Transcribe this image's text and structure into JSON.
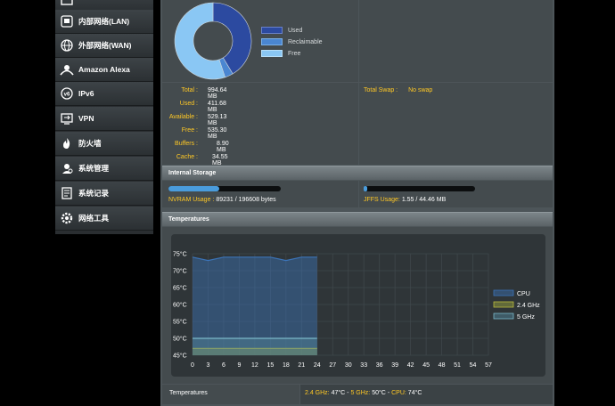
{
  "sidebar": {
    "items": [
      {
        "label": "",
        "icon": "partial-icon"
      },
      {
        "label": "内部网络(LAN)",
        "icon": "lan-icon"
      },
      {
        "label": "外部网络(WAN)",
        "icon": "globe-icon"
      },
      {
        "label": "Amazon Alexa",
        "icon": "alexa-icon"
      },
      {
        "label": "IPv6",
        "icon": "ipv6-icon"
      },
      {
        "label": "VPN",
        "icon": "vpn-icon"
      },
      {
        "label": "防火墙",
        "icon": "firewall-icon"
      },
      {
        "label": "系统管理",
        "icon": "admin-icon"
      },
      {
        "label": "系统记录",
        "icon": "log-icon"
      },
      {
        "label": "网络工具",
        "icon": "tools-icon"
      }
    ]
  },
  "memory": {
    "legend": [
      {
        "label": "Used",
        "color": "#2c4aa0"
      },
      {
        "label": "Reclaimable",
        "color": "#4a86d1"
      },
      {
        "label": "Free",
        "color": "#8ac7f4"
      }
    ],
    "pie_fractions": {
      "used": 0.414,
      "reclaimable": 0.035,
      "free": 0.551
    },
    "stats": [
      {
        "label": "Total :",
        "value": "994.64 MB"
      },
      {
        "label": "Used :",
        "value": "411.68 MB"
      },
      {
        "label": "Available :",
        "value": "529.13 MB"
      },
      {
        "label": "Free :",
        "value": "535.30 MB"
      },
      {
        "label": "Buffers :",
        "value": "8.90 MB"
      },
      {
        "label": "Cache :",
        "value": "34.55 MB"
      }
    ],
    "swap_label": "Total Swap :",
    "swap_value": "No swap"
  },
  "storage": {
    "title": "Internal Storage",
    "nvram_label": "NVRAM Usage :",
    "nvram_value": "89231 / 196608 bytes",
    "nvram_fraction": 0.454,
    "jffs_label": "JFFS Usage:",
    "jffs_value": "1.55 / 44.46 MB",
    "jffs_fraction": 0.035
  },
  "temperatures": {
    "title": "Temperatures",
    "footer_label": "Temperatures",
    "readout": {
      "g24_label": "2.4 GHz:",
      "g24_value": "47°C",
      "sep": "-",
      "g5_label": "5 GHz:",
      "g5_value": "50°C",
      "cpu_label": "CPU:",
      "cpu_value": "74°C"
    }
  },
  "chart_data": {
    "type": "area",
    "x": [
      0,
      3,
      6,
      9,
      12,
      15,
      18,
      21,
      24
    ],
    "x_ticks": [
      "0",
      "3",
      "6",
      "9",
      "12",
      "15",
      "18",
      "21",
      "24",
      "27",
      "30",
      "33",
      "36",
      "39",
      "42",
      "45",
      "48",
      "51",
      "54",
      "57"
    ],
    "y_ticks": [
      "75°C",
      "70°C",
      "65°C",
      "60°C",
      "55°C",
      "50°C",
      "45°C"
    ],
    "xlim": [
      0,
      57
    ],
    "ylim": [
      45,
      75
    ],
    "grid": true,
    "legend_position": "right",
    "series": [
      {
        "name": "CPU",
        "color": "#3b74b8",
        "values": [
          74,
          73,
          74,
          74,
          74,
          74,
          73,
          74,
          74
        ]
      },
      {
        "name": "2.4 GHz",
        "color": "#b8b83c",
        "values": [
          47,
          47,
          47,
          47,
          47,
          47,
          47,
          47,
          47
        ]
      },
      {
        "name": "5 GHz",
        "color": "#7ab8c8",
        "values": [
          50,
          50,
          50,
          50,
          50,
          50,
          50,
          50,
          50
        ]
      }
    ]
  }
}
